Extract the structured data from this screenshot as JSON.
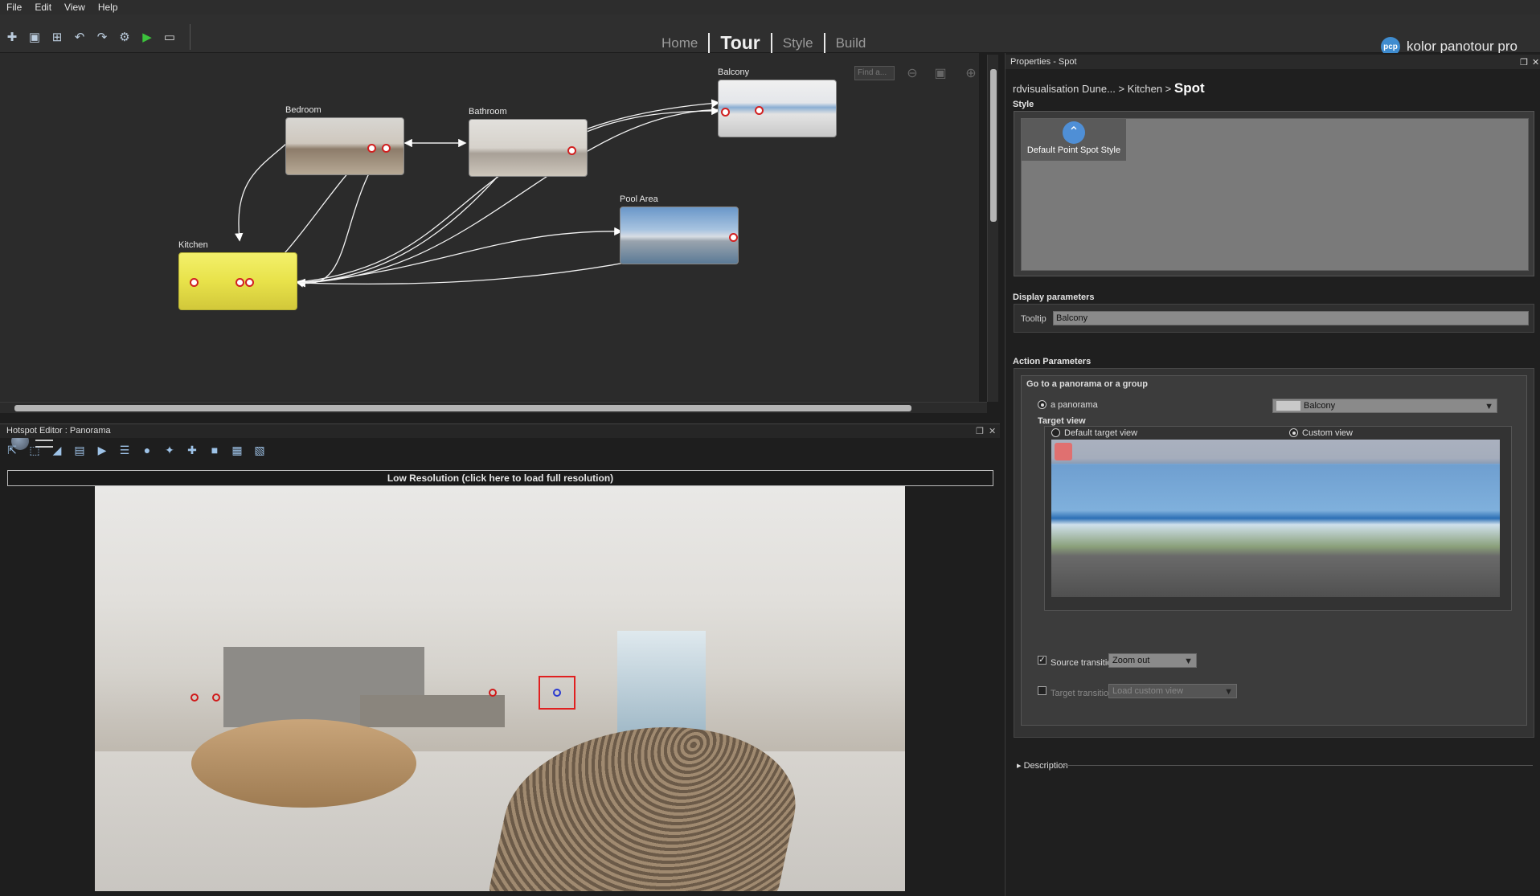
{
  "menu": {
    "items": [
      "File",
      "Edit",
      "View",
      "Help"
    ]
  },
  "nav": {
    "tabs": [
      "Home",
      "Tour",
      "Style",
      "Build"
    ],
    "active": "Tour"
  },
  "brand": {
    "logo_text": "pcp",
    "name": "kolor panotour pro"
  },
  "graph": {
    "search_placeholder": "Find a...",
    "nodes": [
      {
        "label": "Bedroom"
      },
      {
        "label": "Bathroom"
      },
      {
        "label": "Balcony"
      },
      {
        "label": "Pool Area"
      },
      {
        "label": "Kitchen"
      }
    ]
  },
  "hotspot_editor": {
    "title": "Hotspot Editor : Panorama",
    "low_res_label": "Low Resolution (click here to load full resolution)"
  },
  "properties": {
    "title": "Properties - Spot",
    "breadcrumb": {
      "path": "rdvisualisation Dune... > Kitchen > ",
      "current": "Spot"
    },
    "style_section": "Style",
    "style_item": "Default Point Spot Style",
    "display_section": "Display parameters",
    "tooltip_label": "Tooltip",
    "tooltip_value": "Balcony",
    "action_section": "Action Parameters",
    "action_type": "Go to a panorama or a group",
    "radio_panorama": "a panorama",
    "panorama_select": "Balcony",
    "target_view_label": "Target view",
    "default_target": "Default target view",
    "custom_target": "Custom view",
    "source_transition_label": "Source transition",
    "source_transition_value": "Zoom out",
    "source_transition_checked": true,
    "target_transition_label": "Target transition",
    "target_transition_value": "Load custom view",
    "description": "Description"
  }
}
